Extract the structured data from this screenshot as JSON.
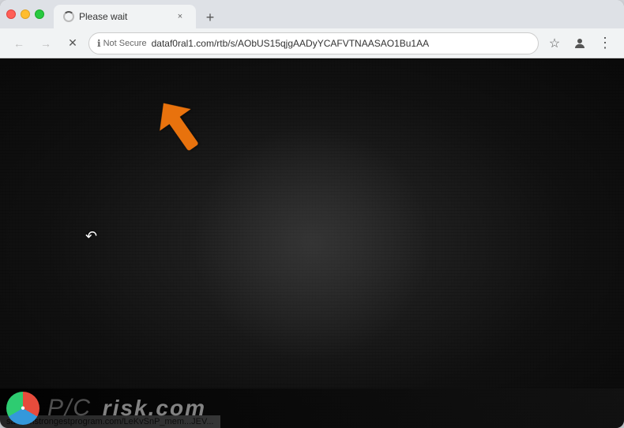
{
  "browser": {
    "traffic_lights": {
      "close_label": "close",
      "minimize_label": "minimize",
      "maximize_label": "maximize"
    },
    "tab": {
      "title": "Please wait",
      "loading": true,
      "close_label": "×"
    },
    "new_tab_label": "+",
    "toolbar": {
      "back_disabled": true,
      "forward_disabled": true,
      "reload_label": "×",
      "not_secure_text": "Not Secure",
      "address": "dataf0ral1.com/rtb/s/AObUS15qjgAADyYCAFVTNAASAO1Bu1AA",
      "bookmark_label": "☆",
      "profile_label": "person",
      "menu_label": "⋮"
    },
    "status_url": "saleamstrongestprogram.com/LeKvSnP_mem...JEV..."
  },
  "page": {
    "background": "dark",
    "watermark": {
      "brand_prefix": "P/C",
      "brand_suffix": "risk.com"
    }
  },
  "arrow": {
    "color": "#e8720c",
    "direction": "up-left"
  }
}
